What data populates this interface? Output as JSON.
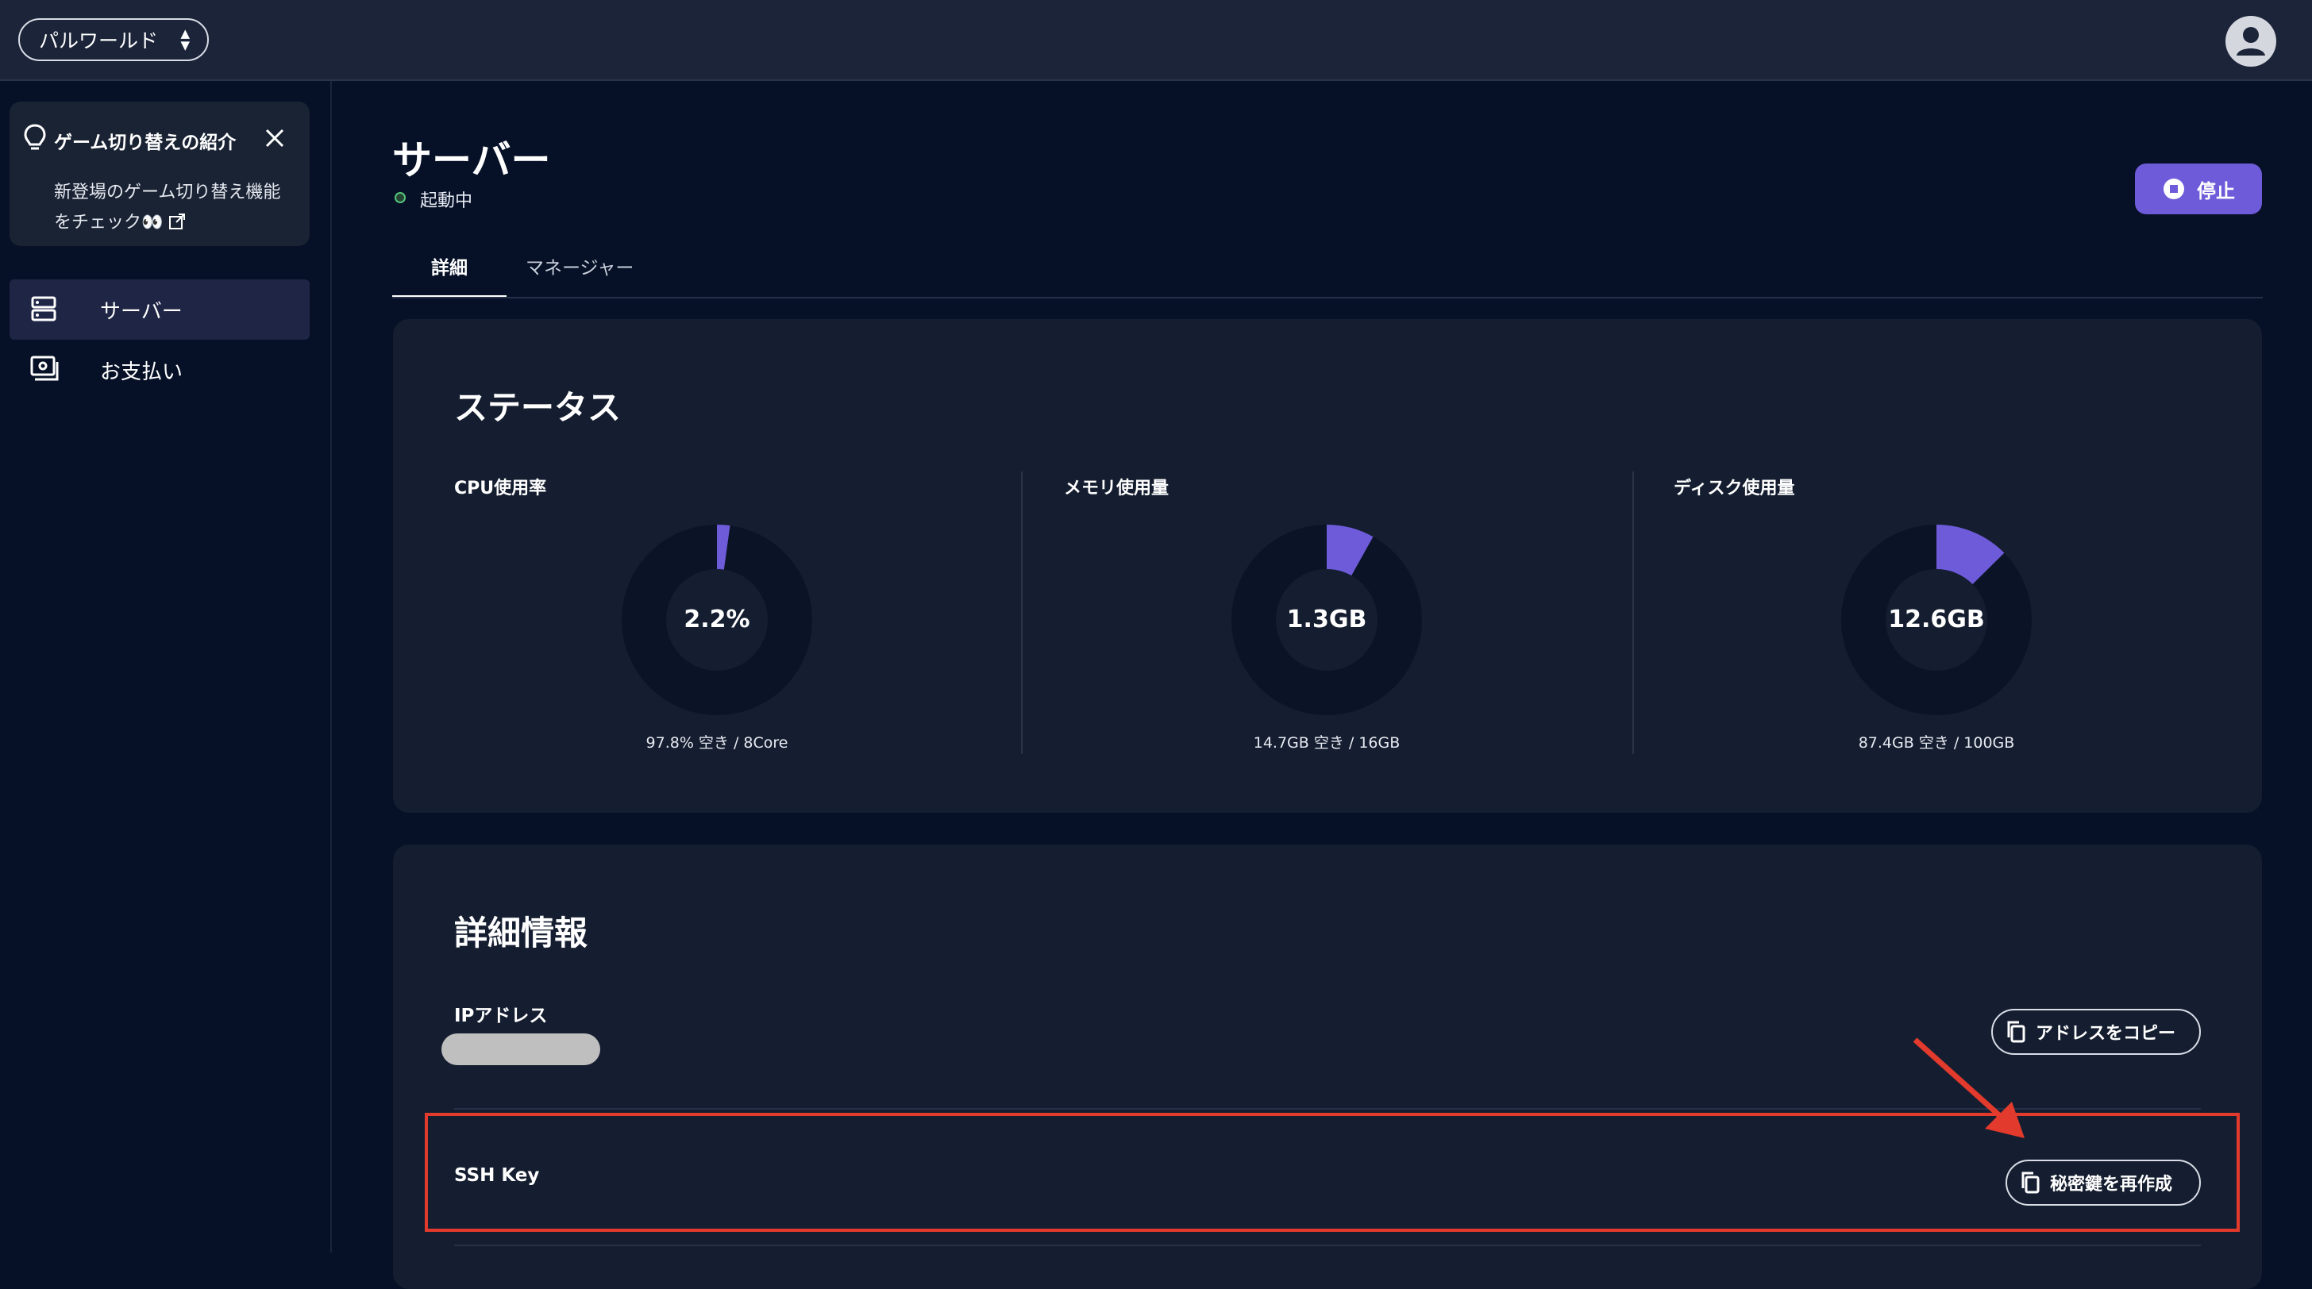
{
  "header": {
    "world_selector": "パルワールド"
  },
  "sidebar": {
    "promo": {
      "title": "ゲーム切り替えの紹介",
      "body": "新登場のゲーム切り替え機能をチェック👀"
    },
    "items": [
      {
        "label": "サーバー"
      },
      {
        "label": "お支払い"
      }
    ]
  },
  "page": {
    "title": "サーバー",
    "status": "起動中",
    "stop_label": "停止",
    "tabs": [
      {
        "label": "詳細"
      },
      {
        "label": "マネージャー"
      }
    ]
  },
  "status_card": {
    "title": "ステータス",
    "metrics": [
      {
        "label": "CPU使用率",
        "value": "2.2%",
        "sub": "97.8% 空き / 8Core",
        "fraction": 0.022
      },
      {
        "label": "メモリ使用量",
        "value": "1.3GB",
        "sub": "14.7GB 空き / 16GB",
        "fraction": 0.081
      },
      {
        "label": "ディスク使用量",
        "value": "12.6GB",
        "sub": "87.4GB 空き / 100GB",
        "fraction": 0.126
      }
    ]
  },
  "details_card": {
    "title": "詳細情報",
    "ip_label": "IPアドレス",
    "copy_address_label": "アドレスをコピー",
    "ssh_label": "SSH Key",
    "regen_key_label": "秘密鍵を再作成"
  },
  "colors": {
    "accent": "#6e5bd9",
    "highlight": "#e23a2c",
    "status_ok": "#55c47a"
  }
}
